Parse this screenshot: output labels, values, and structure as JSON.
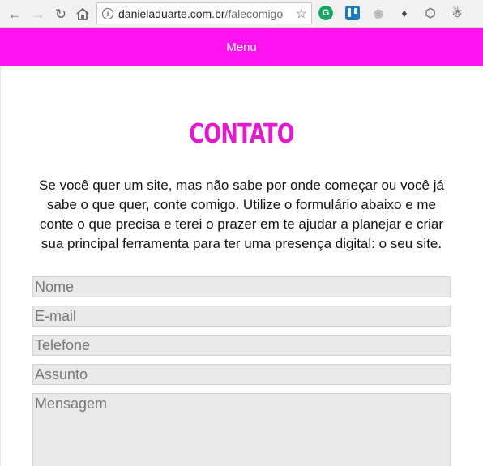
{
  "browser": {
    "url_host": "danieladuarte.com.br",
    "url_path": "/falecomigo",
    "icons": {
      "back": "back-arrow-icon",
      "forward": "forward-arrow-icon",
      "reload": "reload-icon",
      "home": "home-icon",
      "info": "info-icon",
      "bookmark": "star-icon",
      "extensions": [
        "grammarly-icon",
        "trello-icon",
        "camera-icon",
        "evernote-icon",
        "shield-icon",
        "ghost-icon"
      ]
    },
    "info_glyph": "i",
    "grammarly_glyph": "G"
  },
  "site": {
    "menu_label": "Menu",
    "accent_color": "#ff14f0",
    "title_color": "#e31bd0"
  },
  "contact": {
    "title": "CONTATO",
    "intro": "Se você quer um site, mas não sabe por onde começar ou você já sabe o que quer, conte comigo. Utilize o formulário abaixo e me conte o que precisa e terei o prazer em te ajudar a planejar e criar sua principal ferramenta para ter uma presença digital: o seu site.",
    "form": {
      "name_placeholder": "Nome",
      "email_placeholder": "E-mail",
      "phone_placeholder": "Telefone",
      "subject_placeholder": "Assunto",
      "message_placeholder": "Mensagem"
    }
  }
}
